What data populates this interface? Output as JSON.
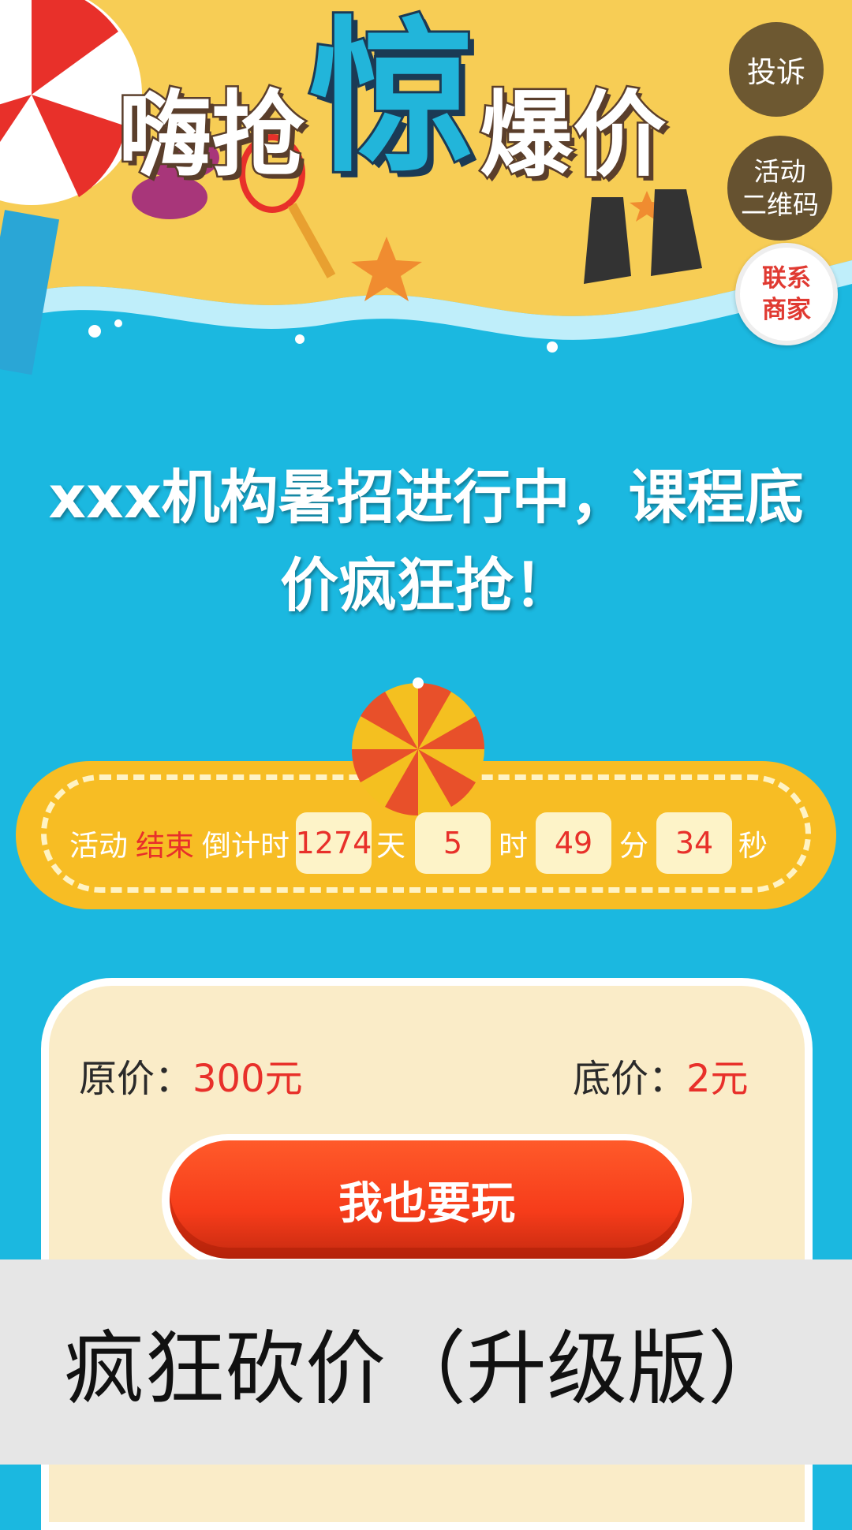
{
  "banner": {
    "title_part1": "嗨抢",
    "title_big": "惊",
    "title_part2": "爆价"
  },
  "side_buttons": {
    "complain": "投诉",
    "qr_line1": "活动",
    "qr_line2": "二维码",
    "contact_line1": "联系",
    "contact_line2": "商家"
  },
  "headline": "xxx机构暑招进行中，课程底价疯狂抢！",
  "countdown": {
    "prefix": "活动",
    "status": "结束",
    "label": "倒计时",
    "days": "1274",
    "days_unit": "天",
    "hours": "5",
    "hours_unit": "时",
    "minutes": "49",
    "minutes_unit": "分",
    "seconds": "34",
    "seconds_unit": "秒"
  },
  "price": {
    "original_label": "原价：",
    "original_value": "300元",
    "floor_label": "底价：",
    "floor_value": "2元"
  },
  "cta_label": "我也要玩",
  "caption": "疯狂砍价（升级版）",
  "colors": {
    "sky": "#1bb8e0",
    "sand": "#f7cd55",
    "accent_red": "#e8302a",
    "count_bar": "#f7bd24"
  }
}
